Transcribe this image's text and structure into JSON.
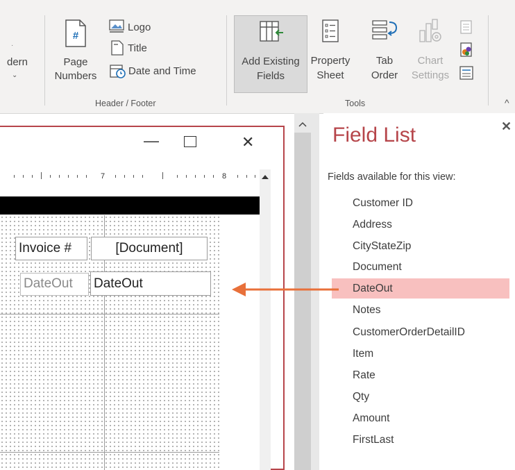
{
  "ribbon": {
    "partial_modern": "dern",
    "header_footer": {
      "page_numbers_line1": "Page",
      "page_numbers_line2": "Numbers",
      "logo": "Logo",
      "title": "Title",
      "date_time": "Date and Time",
      "group_label": "Header / Footer"
    },
    "tools": {
      "add_existing_line1": "Add Existing",
      "add_existing_line2": "Fields",
      "property_line1": "Property",
      "property_line2": "Sheet",
      "tab_line1": "Tab",
      "tab_line2": "Order",
      "chart_line1": "Chart",
      "chart_line2": "Settings",
      "group_label": "Tools"
    }
  },
  "form_window": {
    "minimize": "—",
    "maximize": "☐",
    "close": "✕",
    "ruler_numbers": [
      "7",
      "8"
    ],
    "controls": {
      "invoice_label": "Invoice #",
      "document_field": "[Document]",
      "dateout_label": "DateOut",
      "dateout_field": "DateOut"
    }
  },
  "field_list": {
    "title": "Field List",
    "subtitle": "Fields available for this view:",
    "close": "✕",
    "fields": [
      "Customer ID",
      "Address",
      "CityStateZip",
      "Document",
      "DateOut",
      "Notes",
      "CustomerOrderDetailID",
      "Item",
      "Rate",
      "Qty",
      "Amount",
      "FirstLast"
    ],
    "highlighted_field": "DateOut"
  },
  "colors": {
    "accent_red": "#b6454a",
    "arrow_orange": "#e8703a",
    "highlight_pink": "#f8c0bf"
  }
}
